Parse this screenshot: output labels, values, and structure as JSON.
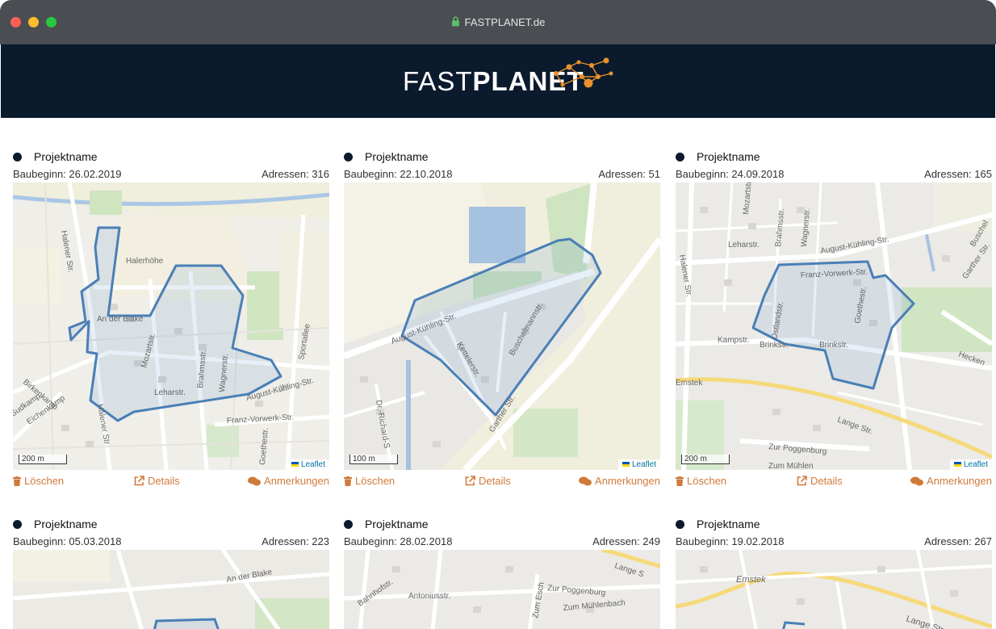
{
  "browser": {
    "url": "FASTPLANET.de"
  },
  "brand": {
    "light": "FAST",
    "bold": "PLANET",
    "accent": "#e8912d",
    "header_bg": "#0b1a2c"
  },
  "actions": {
    "delete": "Löschen",
    "details": "Details",
    "notes": "Anmerkungen"
  },
  "map_labels": {
    "scale_200": "200 m",
    "scale_100": "100 m",
    "attribution": "Leaflet"
  },
  "projects": [
    {
      "name": "Projektname",
      "start": "Baubeginn: 26.02.2019",
      "addresses": "Adressen: 316"
    },
    {
      "name": "Projektname",
      "start": "Baubeginn: 22.10.2018",
      "addresses": "Adressen: 51"
    },
    {
      "name": "Projektname",
      "start": "Baubeginn: 24.09.2018",
      "addresses": "Adressen: 165"
    },
    {
      "name": "Projektname",
      "start": "Baubeginn: 05.03.2018",
      "addresses": "Adressen: 223"
    },
    {
      "name": "Projektname",
      "start": "Baubeginn: 28.02.2018",
      "addresses": "Adressen: 249"
    },
    {
      "name": "Projektname",
      "start": "Baubeginn: 19.02.2018",
      "addresses": "Adressen: 267"
    }
  ],
  "streets": {
    "m1": [
      "Halener Str.",
      "Halerhöhe",
      "An der Blake",
      "Mozartstr.",
      "Brahmsstr.",
      "Wagnerstr.",
      "Leharstr.",
      "August-Kühling-Str.",
      "Sportallee",
      "Birkenkamp",
      "Sudkamp",
      "Eichenkamp",
      "Franz-Vorwerk-Str.",
      "Goethestr.",
      "Halener Str"
    ],
    "m2": [
      "August-Kühling-Str.",
      "Kettelerstr.",
      "Buschelmannstr.",
      "Garther Str.",
      "Dr.-Richard-S"
    ],
    "m3": [
      "Mozartstr.",
      "Brahmsstr.",
      "Wagnerstr.",
      "Leharstr.",
      "August-Kühling-Str.",
      "Franz-Vorwerk-Str.",
      "Kampstr.",
      "Brinkstr.",
      "Brinkstr.",
      "Goethestr.",
      "Ostlandstr.",
      "Halener Str.",
      "Emstek",
      "Lange Str.",
      "Zur Poggenburg",
      "Zum Mühlen",
      "Hecken",
      "Garther Str.",
      "Buschel"
    ],
    "m4": [
      "An der Blake"
    ],
    "m5": [
      "Lange S",
      "Zur Poggenburg",
      "Antoniusstr.",
      "Zum Esch",
      "Zum Mühlenbach",
      "Bahnhofstr."
    ],
    "m6": [
      "Emstek",
      "Lange Str."
    ]
  }
}
